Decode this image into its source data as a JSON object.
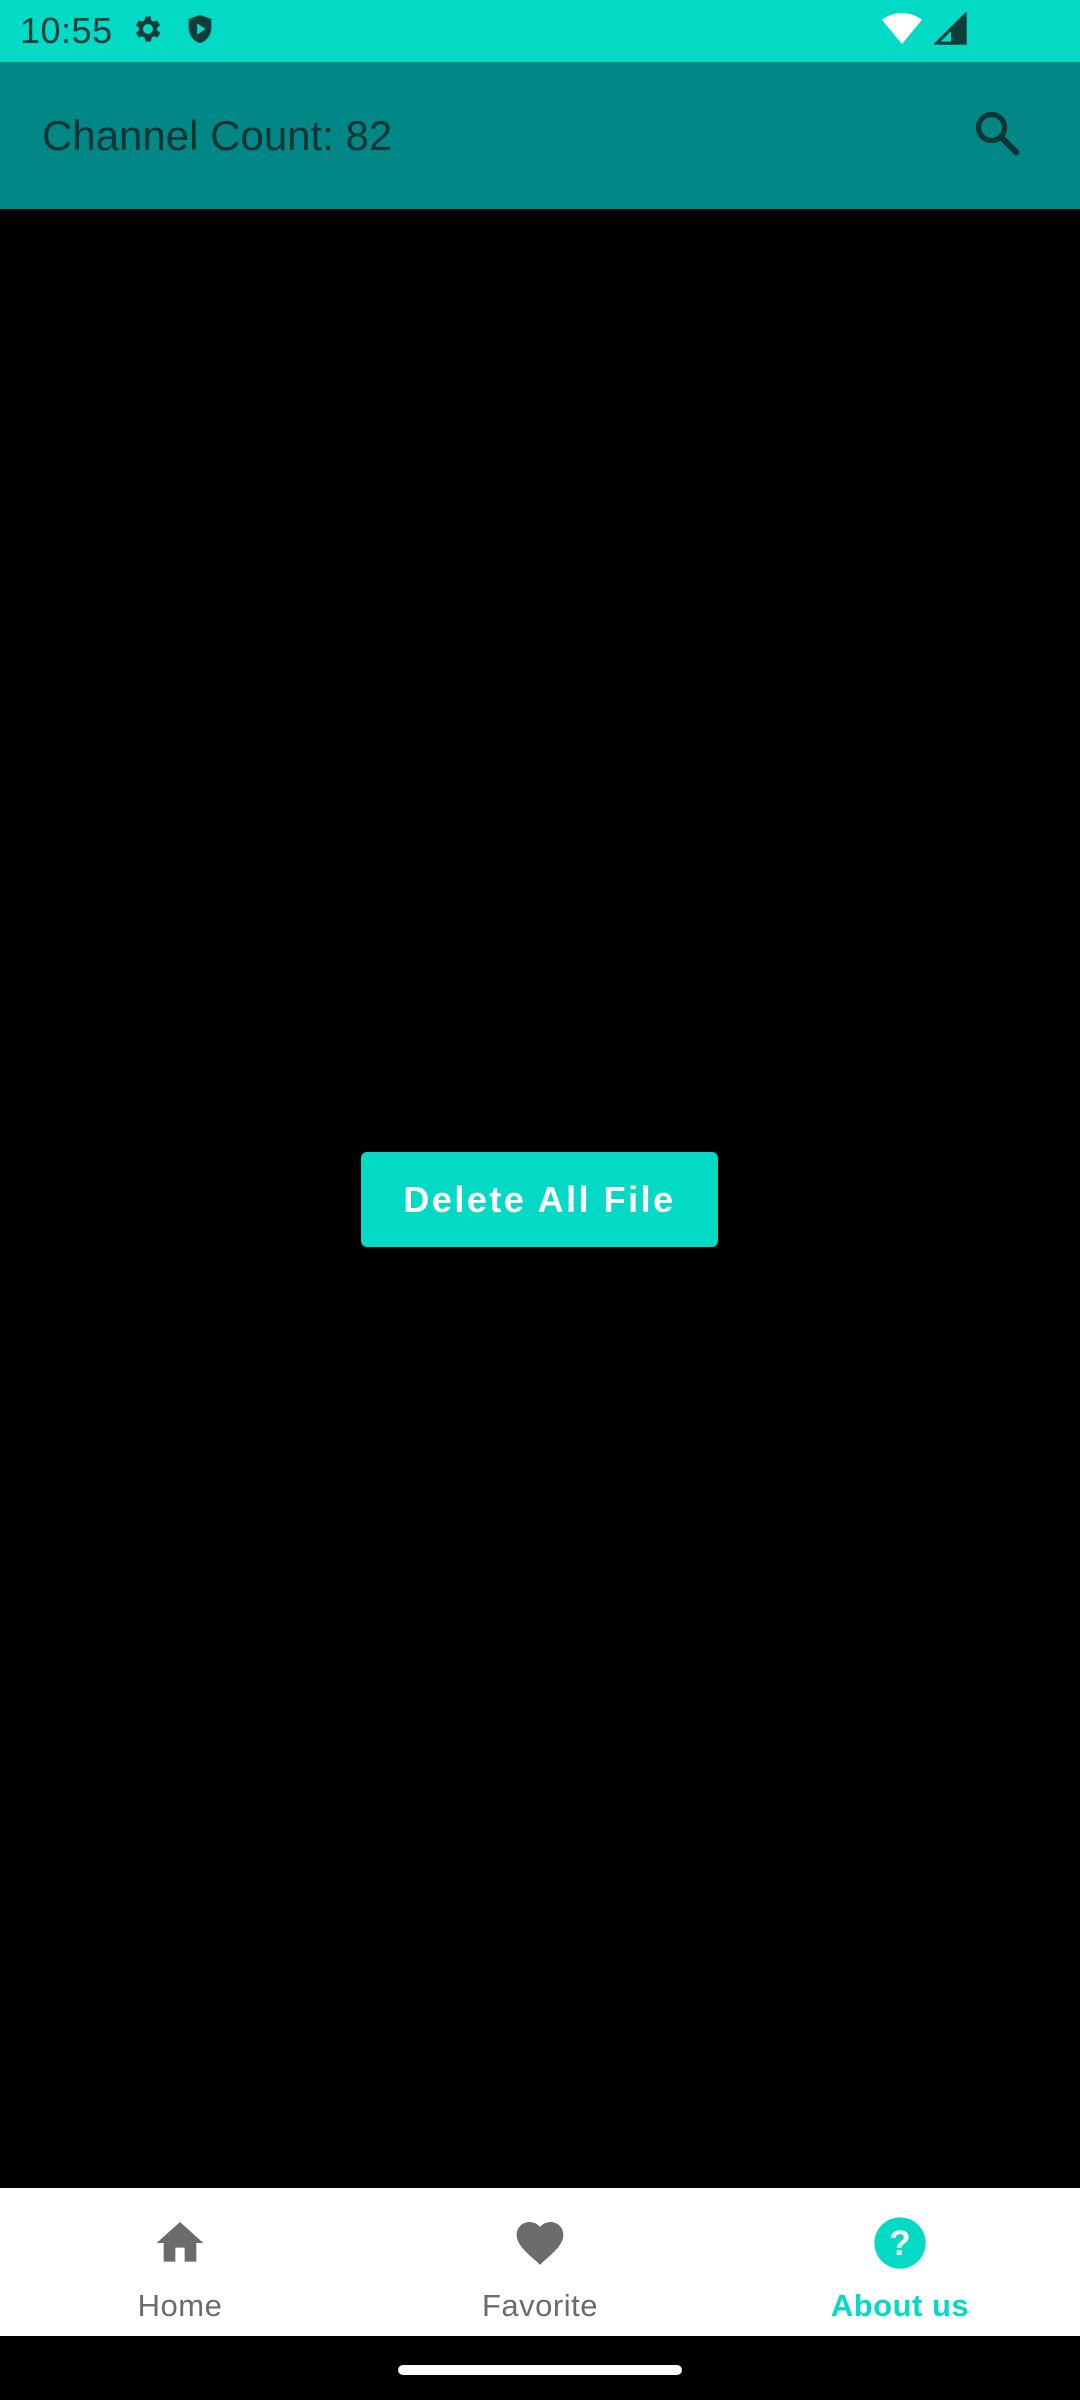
{
  "status_bar": {
    "time": "10:55",
    "icons": [
      "gear-icon",
      "shield-play-icon",
      "wifi-icon",
      "signal-icon"
    ]
  },
  "app_bar": {
    "title": "Channel Count: 82",
    "search_icon": "search-icon"
  },
  "main": {
    "delete_button_label": "Delete All File"
  },
  "bottom_nav": {
    "items": [
      {
        "label": "Home",
        "icon": "home-icon",
        "active": false
      },
      {
        "label": "Favorite",
        "icon": "heart-icon",
        "active": false
      },
      {
        "label": "About us",
        "icon": "help-circle-icon",
        "active": true
      }
    ]
  },
  "colors": {
    "accent": "#03DAC6",
    "app_bar": "#018786",
    "inactive": "#6b6b6b",
    "background": "#000000"
  }
}
